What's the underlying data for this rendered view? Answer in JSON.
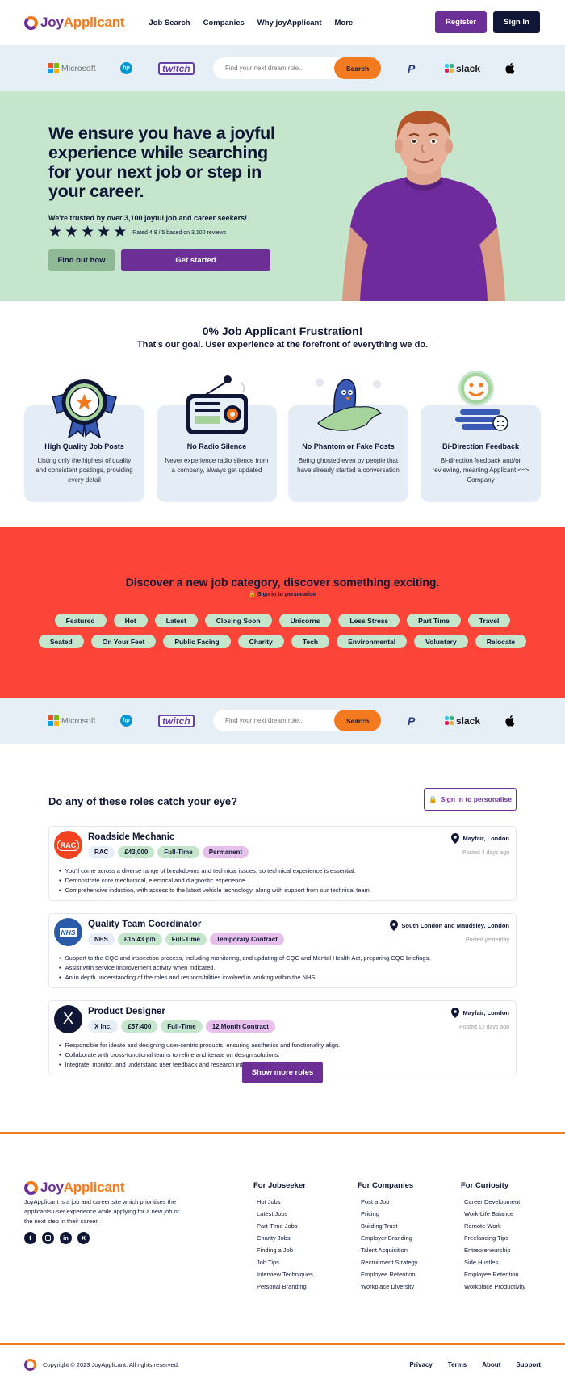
{
  "header": {
    "logo_joy": "Joy",
    "logo_app": "Applicant",
    "nav": [
      "Job Search",
      "Companies",
      "Why joyApplicant",
      "More"
    ],
    "register": "Register",
    "sign_in": "Sign In"
  },
  "brands": {
    "microsoft": "Microsoft",
    "hp": "hp",
    "twitch": "twitch",
    "paypal": "P",
    "slack": "slack",
    "apple": ""
  },
  "search": {
    "placeholder": "Find your next dream role...",
    "button": "Search"
  },
  "hero": {
    "headline": "We ensure you have a joyful experience while searching for your next job or step in your career.",
    "trust": "We're trusted by over 3,100 joyful job and career seekers!",
    "rating": "Rated 4.9 / 5 based on 3,100 reviews",
    "rating_value": 4.9,
    "rating_max": 5,
    "find_out": "Find out how",
    "get_started": "Get started"
  },
  "frustration": {
    "title": "0% Job Applicant Frustration!",
    "subtitle": "That's our goal. User experience at the forefront of everything we do.",
    "features": [
      {
        "icon": "award-medal-icon",
        "title": "High Quality Job Posts",
        "desc": "Listing only the highest of quality and consistent postings, providing every detail"
      },
      {
        "icon": "radio-icon",
        "title": "No Radio Silence",
        "desc": "Never experience radio silence from a company, always get updated"
      },
      {
        "icon": "ghost-bird-icon",
        "title": "No Phantom or Fake Posts",
        "desc": "Being ghosted even by people that have already started a conversation"
      },
      {
        "icon": "feedback-faces-icon",
        "title": "Bi-Direction Feedback",
        "desc": "Bi-direction feedback and/or reviewing, meaning Applicant <=> Company"
      }
    ]
  },
  "categories": {
    "title": "Discover a new job category, discover something exciting.",
    "sign_in": "Sign in to personalise",
    "row1": [
      "Featured",
      "Hot",
      "Latest",
      "Closing Soon",
      "Unicorns",
      "Less Stress",
      "Part Time",
      "Travel"
    ],
    "row2": [
      "Seated",
      "On Your Feet",
      "Public Facing",
      "Charity",
      "Tech",
      "Environmental",
      "Voluntary",
      "Relocate"
    ]
  },
  "roles": {
    "title": "Do any of these roles catch your eye?",
    "sign_in": "Sign in to personalise",
    "show_more": "Show more roles",
    "jobs": [
      {
        "logo_text": "RAC",
        "logo_color": "#f2421f",
        "title": "Roadside Mechanic",
        "company": "RAC",
        "salary": "£43,000",
        "type": "Full-Time",
        "contract": "Permanent",
        "location": "Mayfair, London",
        "posted": "Posted 4 days ago",
        "bullets": [
          "You'll come across a diverse range of breakdowns and technical issues, so technical experience is essential.",
          "Demonstrate core mechanical, electrical and diagnostic experience.",
          "Comprehensive induction, with access to the latest vehicle technology, along with support from our technical team."
        ]
      },
      {
        "logo_text": "NHS",
        "logo_color": "#2a5aa8",
        "title": "Quality Team Coordinator",
        "company": "NHS",
        "salary": "£15.43 p/h",
        "type": "Full-Time",
        "contract": "Temporary Contract",
        "location": "South London and Maudsley, London",
        "posted": "Posted yesterday",
        "bullets": [
          "Support to the CQC and inspection process, including monitoring, and updating of CQC and Mental Health Act, preparing CQC briefings.",
          "Assist with service improvement activity when indicated.",
          "An in depth understanding of the roles and responsibilities involved in working within the NHS."
        ]
      },
      {
        "logo_text": "X",
        "logo_color": "#101736",
        "title": "Product Designer",
        "company": "X Inc.",
        "salary": "£57,400",
        "type": "Full-Time",
        "contract": "12 Month Contract",
        "location": "Mayfair, London",
        "posted": "Posted 12 days ago",
        "bullets": [
          "Responsible for ideate and designing user-centric products, ensuring aesthetics and functionality align.",
          "Collaborate with cross-functional teams to refine and iterate on design solutions.",
          "Integrate, monitor, and understand user feedback and research into design decisions."
        ]
      }
    ]
  },
  "footer": {
    "about": "JoyApplicant is a job and career site which prioritises the applicants user experience while applying for a new job or the next step in their career.",
    "socials": [
      "facebook-icon",
      "instagram-icon",
      "linkedin-icon",
      "x-icon"
    ],
    "columns": [
      {
        "title": "For Jobseeker",
        "links": [
          "Hot Jobs",
          "Latest Jobs",
          "Part-Time Jobs",
          "Charity Jobs",
          "Finding a Job",
          "Job Tips",
          "Interview Techniques",
          "Personal Branding"
        ]
      },
      {
        "title": "For Companies",
        "links": [
          "Post a Job",
          "Pricing",
          "Building Trust",
          "Employer Branding",
          "Talent Acquisition",
          "Recruitment Strategy",
          "Employee Retention",
          "Workplace Diversity"
        ]
      },
      {
        "title": "For Curiosity",
        "links": [
          "Career Development",
          "Work-Life Balance",
          "Remote Work",
          "Freelancing Tips",
          "Entrepreneurship",
          "Side Hustles",
          "Employee Retention",
          "Workplace Productivity"
        ]
      }
    ],
    "copyright": "Copyright © 2023 JoyApplicant. All rights reserved.",
    "links": [
      "Privacy",
      "Terms",
      "About",
      "Support"
    ]
  },
  "colors": {
    "purple": "#6b2f96",
    "orange": "#f47a1f",
    "navy": "#101736",
    "mint": "#c5e5cd",
    "red": "#fd4438",
    "strip": "#e6eef6"
  }
}
